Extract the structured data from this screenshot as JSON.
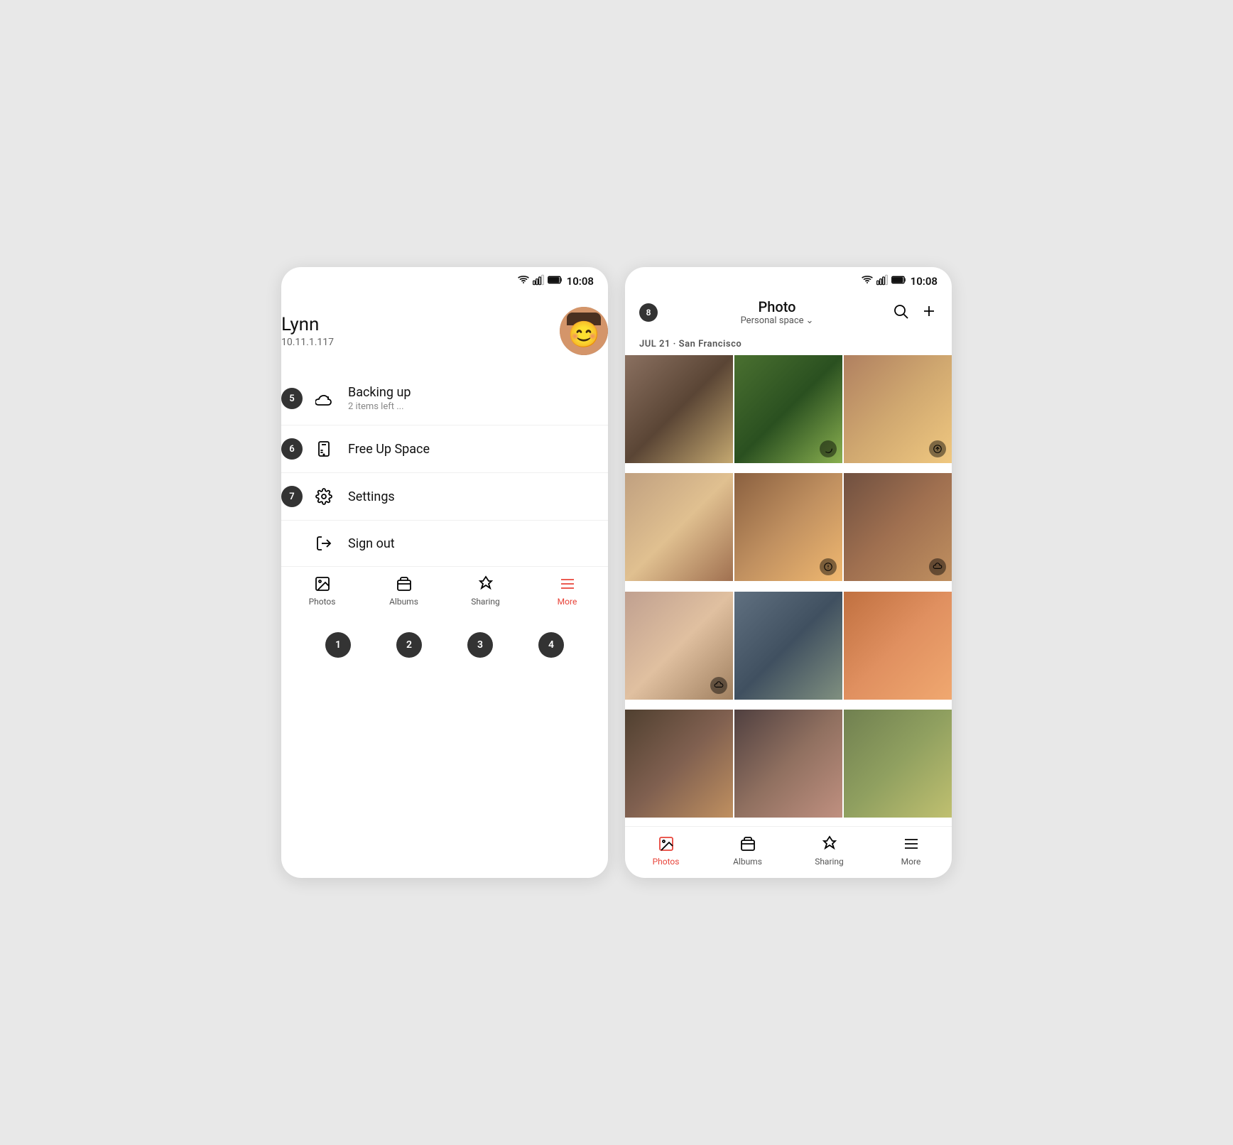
{
  "left_phone": {
    "status": {
      "time": "10:08"
    },
    "user": {
      "name": "Lynn",
      "ip": "10.11.1.117"
    },
    "menu": [
      {
        "id": "backup",
        "badge": "5",
        "title": "Backing up",
        "subtitle": "2 items left ...",
        "icon": "cloud-icon"
      },
      {
        "id": "free-space",
        "badge": "6",
        "title": "Free Up Space",
        "subtitle": "",
        "icon": "phone-icon"
      },
      {
        "id": "settings",
        "badge": "7",
        "title": "Settings",
        "subtitle": "",
        "icon": "settings-icon"
      },
      {
        "id": "signout",
        "badge": "",
        "title": "Sign out",
        "subtitle": "",
        "icon": "signout-icon"
      }
    ],
    "nav": [
      {
        "label": "Photos",
        "icon": "photos-icon",
        "active": false
      },
      {
        "label": "Albums",
        "icon": "albums-icon",
        "active": false
      },
      {
        "label": "Sharing",
        "icon": "sharing-icon",
        "active": false
      },
      {
        "label": "More",
        "icon": "more-icon",
        "active": true
      }
    ],
    "footer_badges": [
      "1",
      "2",
      "3",
      "4"
    ]
  },
  "right_phone": {
    "status": {
      "time": "10:08"
    },
    "header": {
      "title": "Photo",
      "space": "Personal space",
      "badge": "8"
    },
    "date_label": "JUL 21 · San Francisco",
    "photos": [
      {
        "id": 1,
        "cls": "photo-p1",
        "overlay": ""
      },
      {
        "id": 2,
        "cls": "photo-p2",
        "overlay": "spinner"
      },
      {
        "id": 3,
        "cls": "photo-p3",
        "overlay": "upload"
      },
      {
        "id": 4,
        "cls": "photo-p4",
        "overlay": ""
      },
      {
        "id": 5,
        "cls": "photo-p5",
        "overlay": "warning"
      },
      {
        "id": 6,
        "cls": "photo-p6",
        "overlay": "cloud"
      },
      {
        "id": 7,
        "cls": "photo-p7",
        "overlay": "cloud"
      },
      {
        "id": 8,
        "cls": "photo-p8",
        "overlay": ""
      },
      {
        "id": 9,
        "cls": "photo-p9",
        "overlay": ""
      },
      {
        "id": 10,
        "cls": "photo-p10",
        "overlay": ""
      },
      {
        "id": 11,
        "cls": "photo-p11",
        "overlay": ""
      },
      {
        "id": 12,
        "cls": "photo-p12",
        "overlay": ""
      }
    ],
    "nav": [
      {
        "label": "Photos",
        "icon": "photos-icon",
        "active": true
      },
      {
        "label": "Albums",
        "icon": "albums-icon",
        "active": false
      },
      {
        "label": "Sharing",
        "icon": "sharing-icon",
        "active": false
      },
      {
        "label": "More",
        "icon": "more-icon",
        "active": false
      }
    ]
  }
}
